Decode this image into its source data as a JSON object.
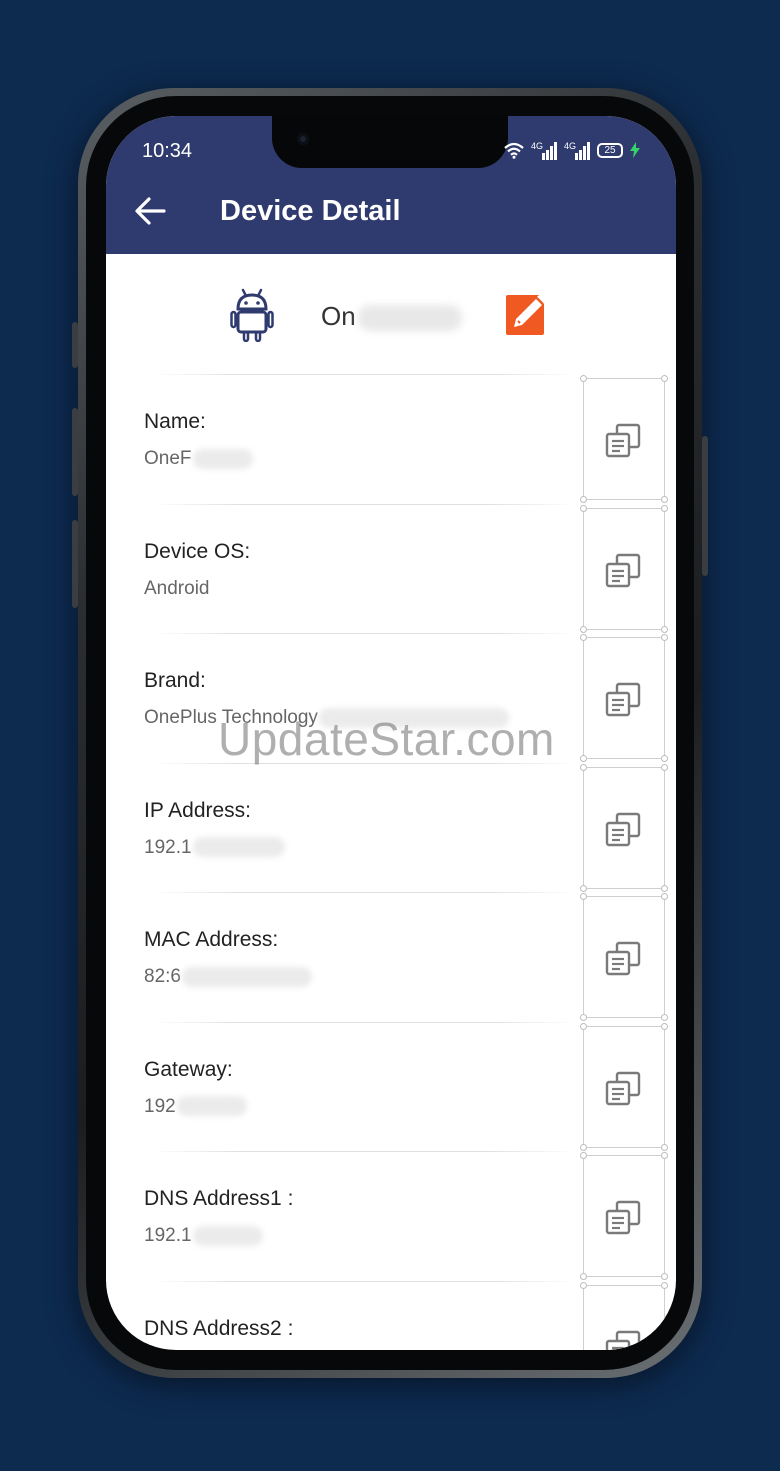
{
  "status_bar": {
    "time": "10:34",
    "battery": "25"
  },
  "app_bar": {
    "title": "Device Detail",
    "back_icon": "arrow-left-icon"
  },
  "device_header": {
    "icon": "android-robot-icon",
    "name_visible": "On",
    "edit_icon": "edit-pencil-icon"
  },
  "rows": [
    {
      "label": "Name:",
      "value": "OneF"
    },
    {
      "label": "Device OS:",
      "value": "Android"
    },
    {
      "label": "Brand:",
      "value": "OnePlus Technology"
    },
    {
      "label": "IP Address:",
      "value": "192.1"
    },
    {
      "label": "MAC Address:",
      "value": "82:6"
    },
    {
      "label": "Gateway:",
      "value": "192"
    },
    {
      "label": "DNS Address1 :",
      "value": "192.1"
    },
    {
      "label": "DNS Address2 :",
      "value": ""
    }
  ],
  "watermark": "UpdateStar.com",
  "colors": {
    "background": "#0d2a4f",
    "app_bar": "#2f3a6e",
    "android_icon": "#2f3a6e",
    "edit_icon": "#f05a22"
  }
}
